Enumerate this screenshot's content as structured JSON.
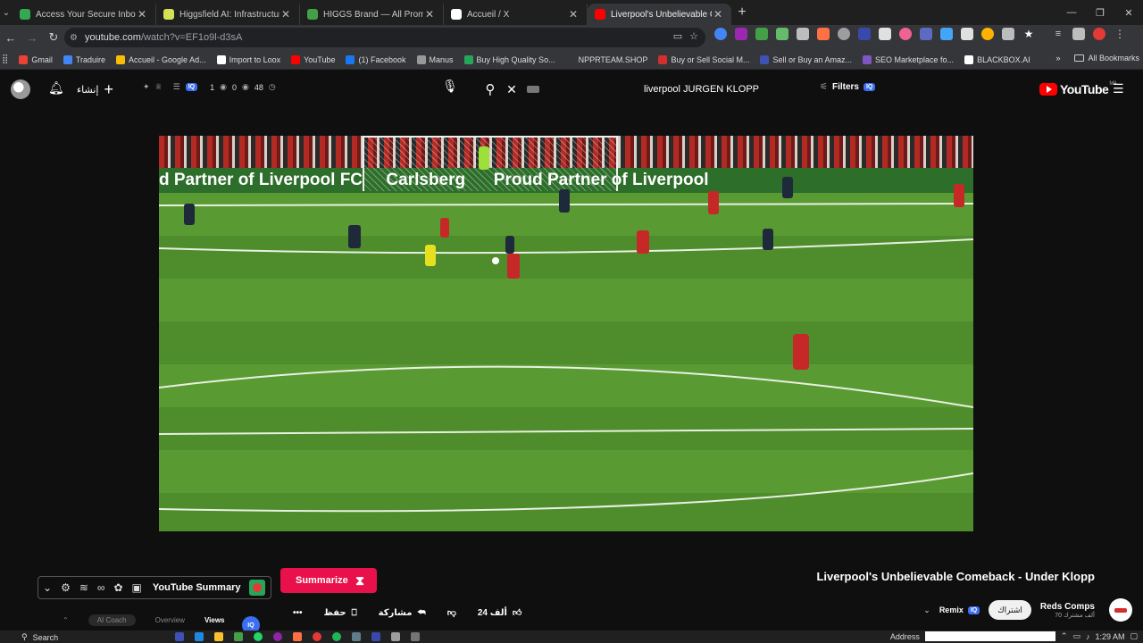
{
  "browser": {
    "tabs": [
      {
        "title": "Access Your Secure Inbox | Atom",
        "favicon_color": "#34a853",
        "active": false
      },
      {
        "title": "Higgsfield AI: Infrastructure for",
        "favicon_color": "#d4e157",
        "active": false
      },
      {
        "title": "HIGGS Brand — All Prompts Us",
        "favicon_color": "#43a047",
        "active": false
      },
      {
        "title": "Accueil / X",
        "favicon_color": "#ffffff",
        "active": false
      },
      {
        "title": "Liverpool's Unbelievable Co",
        "favicon_color": "#ff0000",
        "active": true
      }
    ],
    "url": "youtube.com",
    "url_rest": "/watch?v=EF1o9l-d3sA",
    "bookmarks": [
      {
        "label": "Gmail",
        "color": "#ea4335"
      },
      {
        "label": "Traduire",
        "color": "#4285f4"
      },
      {
        "label": "Accueil - Google Ad...",
        "color": "#fbbc04"
      },
      {
        "label": "Import to Loox",
        "color": "#ffffff"
      },
      {
        "label": "YouTube",
        "color": "#ff0000"
      },
      {
        "label": "(1) Facebook",
        "color": "#1877f2"
      },
      {
        "label": "Manus",
        "color": "#999999"
      },
      {
        "label": "Buy High Quality So...",
        "color": "#26a65b"
      },
      {
        "label": "NPPRTEAM.SHOP",
        "color": "#35363a"
      },
      {
        "label": "Buy or Sell Social M...",
        "color": "#d32f2f"
      },
      {
        "label": "Sell or Buy an Amaz...",
        "color": "#3f51b5"
      },
      {
        "label": "SEO Marketplace fo...",
        "color": "#7e57c2"
      },
      {
        "label": "BLACKBOX.AI",
        "color": "#ffffff"
      }
    ],
    "all_bookmarks": "All Bookmarks"
  },
  "youtube": {
    "create_label": "إنشاء",
    "stats": {
      "a": "1",
      "b": "0",
      "c": "48"
    },
    "search_query": "liverpool  JURGEN KLOPP",
    "filters_label": "Filters",
    "iq_label": "IQ",
    "logo_text": "YouTube",
    "logo_region": "MA"
  },
  "video": {
    "adboard_text": "d Partner of Liverpool FC     Carlsberg      Proud Partner of Liverpool",
    "title": "Liverpool's Unbelievable Comeback - Under Klopp"
  },
  "toolbar": {
    "youtube_summary": "YouTube Summary",
    "summarize": "Summarize",
    "tabs": [
      "AI Coach",
      "Overview",
      "Views"
    ]
  },
  "actions": {
    "more": "•••",
    "save": "حفظ",
    "share": "مشاركة",
    "likes": "24 ألف"
  },
  "channel": {
    "name": "Reds Comps",
    "subscribers": "70 ألف مشترك",
    "subscribe": "اشتراك",
    "remix": "Remix"
  },
  "taskbar": {
    "search": "Search",
    "address_label": "Address",
    "time": "1:29 AM"
  }
}
